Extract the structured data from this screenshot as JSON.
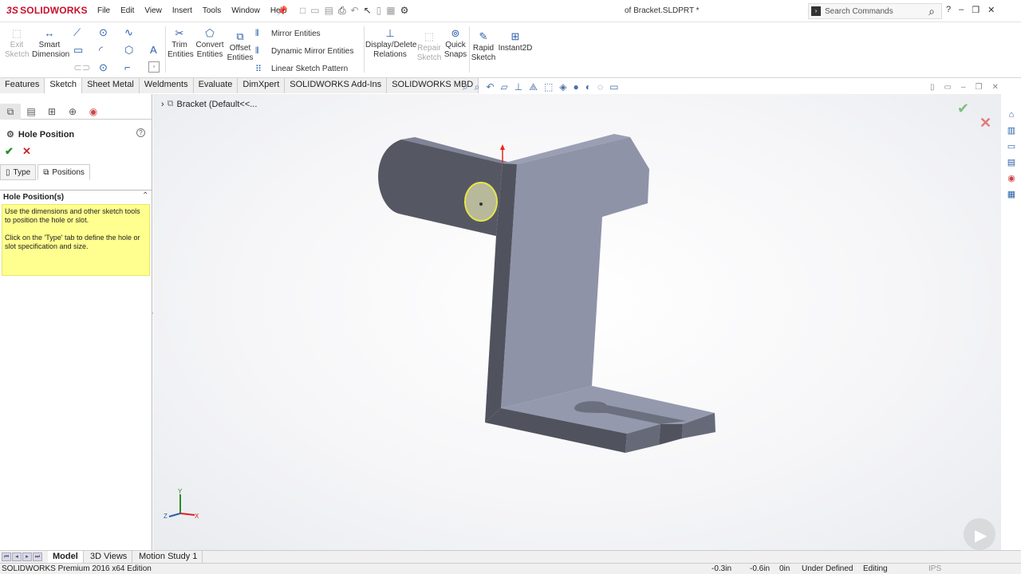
{
  "app": {
    "logo": "SOLIDWORKS",
    "doc_title": "of Bracket.SLDPRT *"
  },
  "menu": [
    "File",
    "Edit",
    "View",
    "Insert",
    "Tools",
    "Window",
    "Help"
  ],
  "search": {
    "placeholder": "Search Commands"
  },
  "window_controls": {
    "help": "?",
    "minimize": "–",
    "restore": "❐",
    "close": "✕"
  },
  "commands": {
    "exit_sketch": "Exit\nSketch",
    "smart_dimension": "Smart\nDimension",
    "trim_entities": "Trim\nEntities",
    "convert_entities": "Convert\nEntities",
    "offset_entities": "Offset\nEntities",
    "mirror_entities": "Mirror Entities",
    "dynamic_mirror": "Dynamic Mirror Entities",
    "linear_pattern": "Linear Sketch Pattern",
    "display_delete_relations": "Display/Delete\nRelations",
    "repair_sketch": "Repair\nSketch",
    "quick_snaps": "Quick\nSnaps",
    "rapid_sketch": "Rapid\nSketch",
    "instant2d": "Instant2D"
  },
  "tabs": [
    "Features",
    "Sketch",
    "Sheet Metal",
    "Weldments",
    "Evaluate",
    "DimXpert",
    "SOLIDWORKS Add-Ins",
    "SOLIDWORKS MBD"
  ],
  "active_tab": "Sketch",
  "tree_flyout": "Bracket  (Default<<...",
  "property_manager": {
    "title": "Hole Position",
    "tab_type": "Type",
    "tab_positions": "Positions",
    "section": "Hole Position(s)",
    "msg1": "Use the dimensions and other sketch tools to position the hole or slot.",
    "msg2": "Click on the 'Type' tab to define the hole or slot specification and size."
  },
  "triad": {
    "y": "Y",
    "x": "X",
    "z": "Z"
  },
  "bottom_tabs": [
    "Model",
    "3D Views",
    "Motion Study 1"
  ],
  "status": {
    "edition": "SOLIDWORKS Premium 2016 x64 Edition",
    "x": "-0.3in",
    "y": "-0.6in",
    "z": "0in",
    "state": "Under Defined",
    "mode": "Editing",
    "units": "IPS"
  },
  "colors": {
    "part_face_dark": "#5c5f6b",
    "part_face_light": "#8d92a8",
    "hole_highlight": "#e6e64a",
    "yellow_msg": "#ffff8f"
  }
}
